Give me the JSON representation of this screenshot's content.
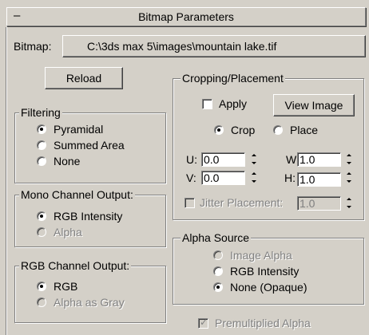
{
  "rollout": {
    "collapse_glyph": "–",
    "title": "Bitmap Parameters"
  },
  "bitmap": {
    "label": "Bitmap:",
    "path": "C:\\3ds max 5\\images\\mountain lake.tif"
  },
  "reload_label": "Reload",
  "filtering": {
    "title": "Filtering",
    "options": [
      {
        "label": "Pyramidal",
        "checked": true
      },
      {
        "label": "Summed Area",
        "checked": false
      },
      {
        "label": "None",
        "checked": false
      }
    ]
  },
  "mono_output": {
    "title": "Mono Channel Output:",
    "options": [
      {
        "label": "RGB Intensity",
        "checked": true
      },
      {
        "label": "Alpha",
        "checked": false
      }
    ]
  },
  "rgb_output": {
    "title": "RGB Channel Output:",
    "options": [
      {
        "label": "RGB",
        "checked": true
      },
      {
        "label": "Alpha as Gray",
        "checked": false
      }
    ]
  },
  "cropping": {
    "title": "Cropping/Placement",
    "apply_label": "Apply",
    "apply_checked": false,
    "view_image_label": "View Image",
    "crop_label": "Crop",
    "place_label": "Place",
    "mode": "crop",
    "u_label": "U:",
    "u_value": "0.0",
    "v_label": "V:",
    "v_value": "0.0",
    "w_label": "W:",
    "w_value": "1.0",
    "h_label": "H:",
    "h_value": "1.0",
    "jitter_label": "Jitter Placement:",
    "jitter_value": "1.0",
    "jitter_checked": false
  },
  "alpha_source": {
    "title": "Alpha Source",
    "options": [
      {
        "label": "Image Alpha",
        "checked": false
      },
      {
        "label": "RGB Intensity",
        "checked": false
      },
      {
        "label": "None (Opaque)",
        "checked": true
      }
    ]
  },
  "premultiplied": {
    "label": "Premultiplied Alpha",
    "checked": true
  }
}
